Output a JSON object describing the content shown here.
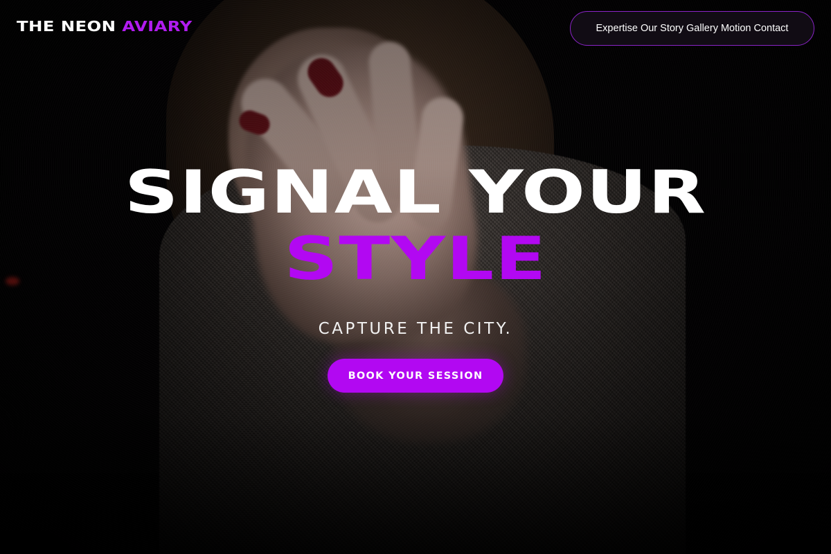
{
  "brand": {
    "name_part1": "THE NEON",
    "name_part2": "AVIARY"
  },
  "nav": {
    "items": [
      {
        "label": "Expertise"
      },
      {
        "label": "Our Story"
      },
      {
        "label": "Gallery"
      },
      {
        "label": "Motion"
      },
      {
        "label": "Contact"
      }
    ]
  },
  "hero": {
    "headline_line1": "SIGNAL YOUR",
    "headline_line2": "STYLE",
    "tagline": "CAPTURE THE CITY.",
    "cta_label": "BOOK YOUR SESSION"
  },
  "colors": {
    "accent": "#b208f2",
    "background": "#000000",
    "text": "#ffffff",
    "nav_border": "#8b24c8"
  }
}
